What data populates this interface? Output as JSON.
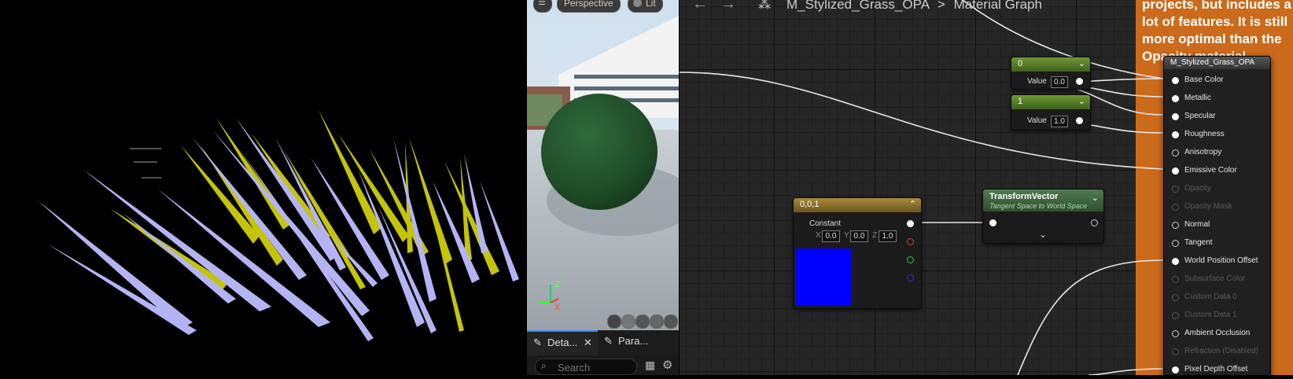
{
  "viewport_toolbar": {
    "perspective_label": "Perspective",
    "lit_label": "Lit"
  },
  "preview": {
    "axis_z": "Z",
    "axis_x": "X"
  },
  "details": {
    "tab_details": "Deta...",
    "tab_params": "Para...",
    "search_placeholder": "Search"
  },
  "graph": {
    "asset_name": "M_Stylized_Grass_OPA",
    "separator": ">",
    "graph_name": "Material Graph",
    "comment_text": "projects, but includes a lot of features. It is still more optimal than the Opacity material",
    "nodes": {
      "scalar_0": {
        "title": "0",
        "value_label": "Value",
        "value": "0.0",
        "header_color": "#5a7f2a"
      },
      "scalar_1": {
        "title": "1",
        "value_label": "Value",
        "value": "1.0",
        "header_color": "#5a7f2a"
      },
      "const3": {
        "title": "0,0,1",
        "label": "Constant",
        "x": "0.0",
        "y": "0.0",
        "z": "1.0",
        "swatch": "#0000ff",
        "header_color": "#8a7430"
      },
      "transform": {
        "title": "TransformVector",
        "subtitle": "Tangent Space to World Space",
        "header_color": "#3e6b3e"
      }
    },
    "main_node": {
      "title": "M_Stylized_Grass_OPA",
      "inputs": [
        {
          "label": "Base Color",
          "enabled": true,
          "connected": true
        },
        {
          "label": "Metallic",
          "enabled": true,
          "connected": true
        },
        {
          "label": "Specular",
          "enabled": true,
          "connected": true
        },
        {
          "label": "Roughness",
          "enabled": true,
          "connected": true
        },
        {
          "label": "Anisotropy",
          "enabled": true,
          "connected": false
        },
        {
          "label": "Emissive Color",
          "enabled": true,
          "connected": true
        },
        {
          "label": "Opacity",
          "enabled": false,
          "connected": false
        },
        {
          "label": "Opacity Mask",
          "enabled": false,
          "connected": false
        },
        {
          "label": "Normal",
          "enabled": true,
          "connected": false
        },
        {
          "label": "Tangent",
          "enabled": true,
          "connected": false
        },
        {
          "label": "World Position Offset",
          "enabled": true,
          "connected": true
        },
        {
          "label": "Subsurface Color",
          "enabled": false,
          "connected": false
        },
        {
          "label": "Custom Data 0",
          "enabled": false,
          "connected": false
        },
        {
          "label": "Custom Data 1",
          "enabled": false,
          "connected": false
        },
        {
          "label": "Ambient Occlusion",
          "enabled": true,
          "connected": false
        },
        {
          "label": "Refraction (Disabled)",
          "enabled": false,
          "connected": false
        },
        {
          "label": "Pixel Depth Offset",
          "enabled": true,
          "connected": true
        }
      ]
    }
  },
  "colors": {
    "grass_lavender": "#b4b4f4",
    "grass_yellow": "#c4c40a",
    "comment_orange": "#cc6a1c"
  }
}
